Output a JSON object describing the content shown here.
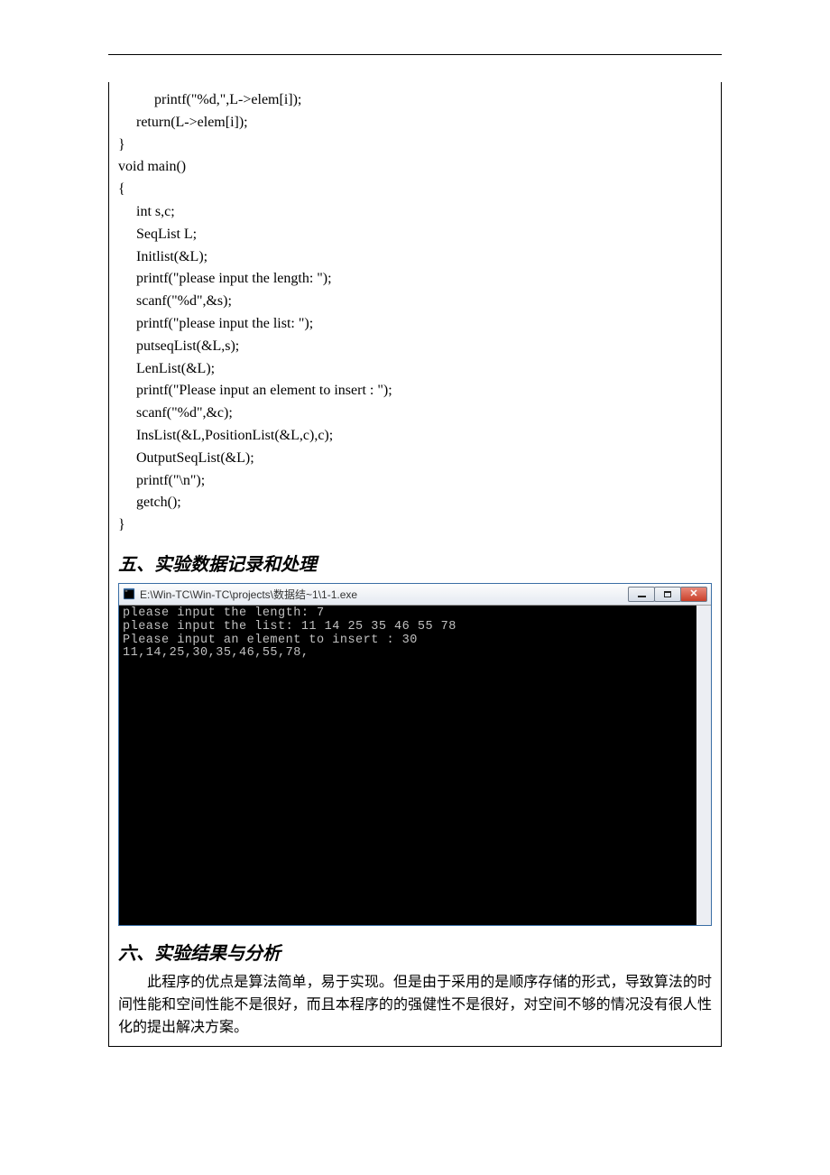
{
  "code": {
    "l1": "          printf(\"%d,\",L->elem[i]);",
    "l2": "     return(L->elem[i]);",
    "l3": "}",
    "l4": "void main()",
    "l5": "{",
    "l6": "     int s,c;",
    "l7": "     SeqList L;",
    "l8": "     Initlist(&L);",
    "l9": "     printf(\"please input the length: \");",
    "l10": "     scanf(\"%d\",&s);",
    "l11": "     printf(\"please input the list: \");",
    "l12": "     putseqList(&L,s);",
    "l13": "     LenList(&L);",
    "l14": "     printf(\"Please input an element to insert : \");",
    "l15": "     scanf(\"%d\",&c);",
    "l16": "     InsList(&L,PositionList(&L,c),c);",
    "l17": "     OutputSeqList(&L);",
    "l18": "     printf(\"\\n\");",
    "l19": "     getch();",
    "l20": "}"
  },
  "section5": {
    "heading": "五、实验数据记录和处理"
  },
  "terminal": {
    "title": "E:\\Win-TC\\Win-TC\\projects\\数据结~1\\1-1.exe",
    "output": "please input the length: 7\nplease input the list: 11 14 25 35 46 55 78\nPlease input an element to insert : 30\n11,14,25,30,35,46,55,78,"
  },
  "section6": {
    "heading": "六、实验结果与分析",
    "body": "此程序的优点是算法简单，易于实现。但是由于采用的是顺序存储的形式，导致算法的时间性能和空间性能不是很好，而且本程序的的强健性不是很好，对空间不够的情况没有很人性化的提出解决方案。"
  }
}
